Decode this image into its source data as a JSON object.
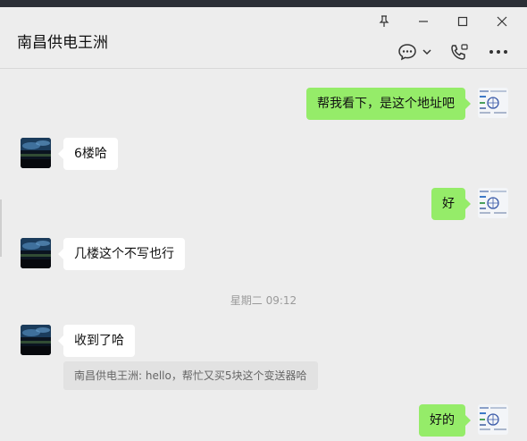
{
  "window": {
    "pin_icon": "pin-icon",
    "minimize_icon": "minimize-icon",
    "maximize_icon": "maximize-icon",
    "close_icon": "close-icon"
  },
  "header": {
    "title": "南昌供电王洲",
    "chat_icon": "chat-bubble-icon",
    "dropdown_icon": "chevron-down-icon",
    "call_icon": "video-call-icon",
    "more_icon": "more-icon"
  },
  "messages": [
    {
      "side": "right",
      "text": "帮我看下，是这个地址吧"
    },
    {
      "side": "left",
      "text": "6楼哈"
    },
    {
      "side": "right",
      "text": "好"
    },
    {
      "side": "left",
      "text": "几楼这个不写也行"
    },
    {
      "type": "time",
      "text": "星期二 09:12"
    },
    {
      "side": "left",
      "text": "收到了哈",
      "quote": "南昌供电王洲: hello，帮忙又买5块这个变送器哈"
    },
    {
      "side": "right",
      "text": "好的"
    }
  ],
  "colors": {
    "background": "#ededed",
    "outgoing_bubble": "#95ec69",
    "incoming_bubble": "#ffffff",
    "timestamp": "#9a9a9a"
  }
}
